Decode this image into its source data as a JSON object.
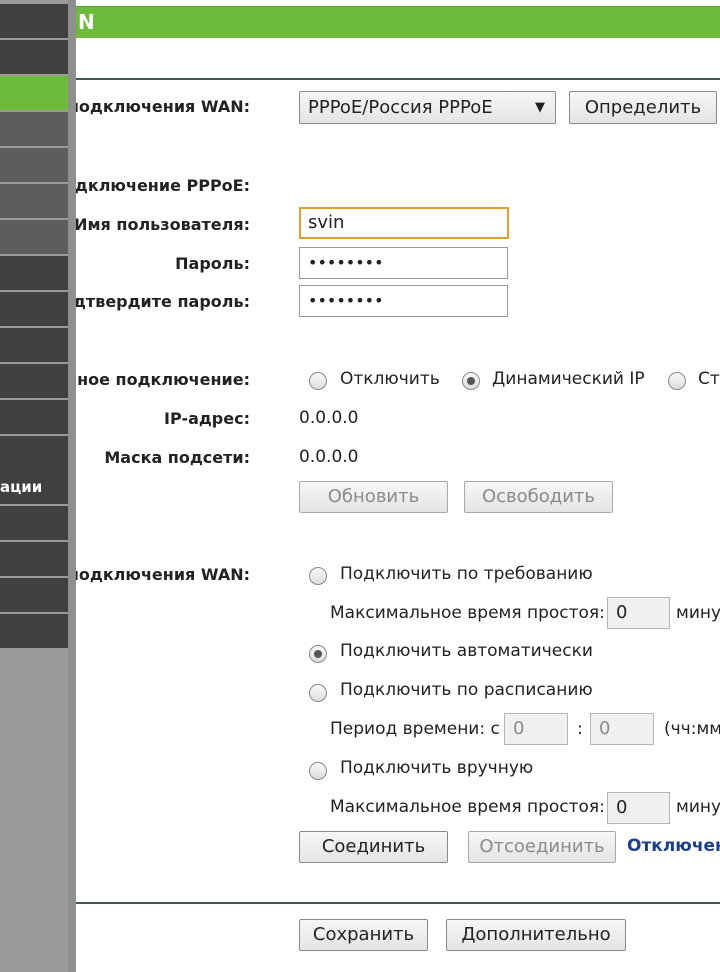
{
  "sidebar": {
    "items": [
      {
        "label": ""
      },
      {
        "label": ""
      },
      {
        "label": ""
      },
      {
        "label": ""
      },
      {
        "label": ""
      },
      {
        "label": ""
      },
      {
        "label": ""
      },
      {
        "label": ""
      },
      {
        "label": ""
      },
      {
        "label": ""
      },
      {
        "label": ""
      },
      {
        "label": ""
      },
      {
        "label": "ации"
      },
      {
        "label": ""
      },
      {
        "label": ""
      },
      {
        "label": ""
      },
      {
        "label": ""
      }
    ]
  },
  "header": {
    "title": "N"
  },
  "wan_type": {
    "label": "и подключения WAN:",
    "selected": "PPPoE/Россия PPPoE",
    "detect_button": "Определить"
  },
  "pppoe": {
    "section_label": "Подключение PPPoE:",
    "username_label": "Имя пользователя:",
    "username_value": "svin",
    "password_label": "Пароль:",
    "password_value": "••••••••",
    "confirm_label": "Подтвердите пароль:",
    "confirm_value": "••••••••"
  },
  "secondary": {
    "label": "ичное подключение:",
    "options": [
      "Отключить",
      "Динамический IP",
      "Ста"
    ],
    "ip_label": "IP-адрес:",
    "ip_value": "0.0.0.0",
    "mask_label": "Маска подсети:",
    "mask_value": "0.0.0.0",
    "renew_button": "Обновить",
    "release_button": "Освободить"
  },
  "wan_mode": {
    "label": "и подключения WAN:",
    "on_demand": "Подключить по требованию",
    "idle_label": "Максимальное время простоя:",
    "idle_value": "0",
    "idle_unit": "мину",
    "auto": "Подключить автоматически",
    "scheduled": "Подключить по расписанию",
    "period_label": "Период времени:  с",
    "period_from": "0",
    "period_colon": ":",
    "period_to": "0",
    "period_unit": "(чч:мм",
    "manual": "Подключить вручную",
    "idle_label2": "Максимальное время простоя:",
    "idle_value2": "0",
    "idle_unit2": "мину",
    "connect_button": "Соединить",
    "disconnect_button": "Отсоединить",
    "status": "Отключено"
  },
  "footer": {
    "save_button": "Сохранить",
    "advanced_button": "Дополнительно"
  }
}
